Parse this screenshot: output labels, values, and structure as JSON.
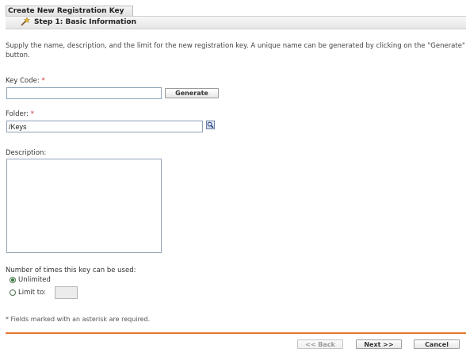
{
  "header": {
    "title": "Create New Registration Key",
    "step_title": "Step 1: Basic Information"
  },
  "instructions": "Supply the name, description, and the limit for the new registration key. A unique name can be generated by clicking on the \"Generate\" button.",
  "form": {
    "key_code": {
      "label": "Key Code: ",
      "required_mark": "*",
      "value": ""
    },
    "generate_label": "Generate",
    "folder": {
      "label": "Folder: ",
      "required_mark": "*",
      "value": "/Keys"
    },
    "description": {
      "label": "Description:",
      "value": ""
    },
    "usage": {
      "label": "Number of times this key can be used:",
      "options": [
        {
          "label": "Unlimited",
          "checked": true
        },
        {
          "label": "Limit to:",
          "checked": false
        }
      ],
      "limit_value": ""
    },
    "required_note": "* Fields marked with an asterisk are required."
  },
  "buttons": {
    "back": "<< Back",
    "next": "Next >>",
    "cancel": "Cancel"
  },
  "icons": {
    "step": "wand-icon",
    "folder_browse": "search-icon"
  },
  "colors": {
    "accent_rule": "#e8752a",
    "radio_checked": "#2e7d32"
  }
}
